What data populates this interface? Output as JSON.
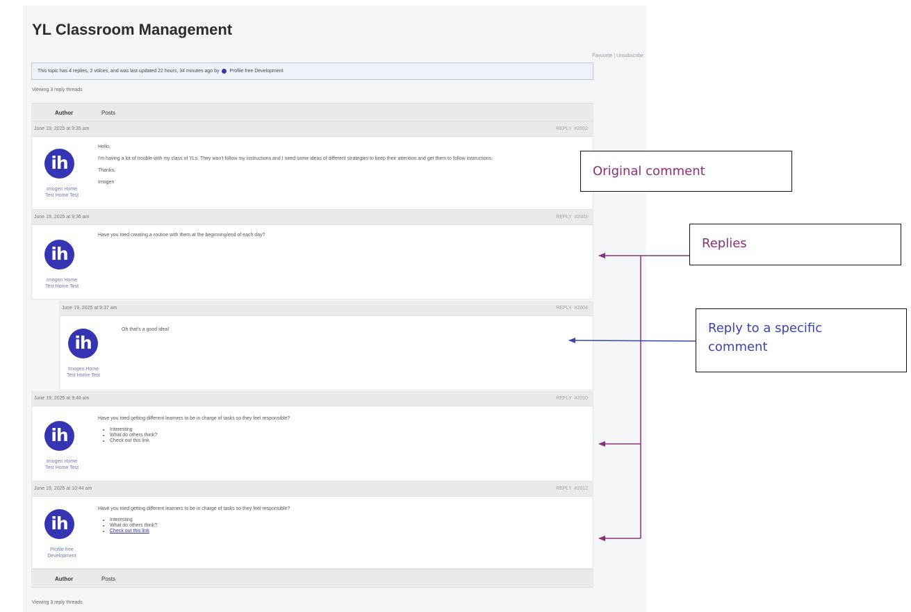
{
  "topic": {
    "title": "YL Classroom Management",
    "favorite_label": "Favourite",
    "separator": "|",
    "unsubscribe_label": "Unsubscribe",
    "notice_text": "This topic has 4 replies, 2 voices, and was last updated 22 hours, 34 minutes ago by",
    "notice_author": "Profile free Development",
    "viewing_text": "Viewing 3 reply threads",
    "col_author": "Author",
    "col_posts": "Posts"
  },
  "replies": [
    {
      "date": "June 19, 2025 at 9:35 am",
      "reply_label": "REPLY",
      "post_id": "#2002",
      "avatar_text": "ih",
      "author": [
        "Imogen Home",
        "Test Home Test"
      ],
      "paragraphs": [
        "Hello,",
        "I'm having a lot of trouble with my class of YLs. They won't follow my instructions and I need some ideas of different strategies to keep their attention and get them to follow instructions.",
        "Thanks,",
        "Imogen"
      ]
    },
    {
      "date": "June 19, 2025 at 9:36 am",
      "reply_label": "REPLY",
      "post_id": "#2003",
      "avatar_text": "ih",
      "author": [
        "Imogen Home",
        "Test Home Test"
      ],
      "paragraphs": [
        "Have you tried creating a routine with them at the beginning/end of each day?"
      ]
    },
    {
      "date": "June 19, 2025 at 9:37 am",
      "reply_label": "REPLY",
      "post_id": "#2004",
      "avatar_text": "ih",
      "author": [
        "Imogen Home",
        "Test Home Test"
      ],
      "paragraphs": [
        "Oh that's a good idea!"
      ]
    },
    {
      "date": "June 19, 2025 at 9:48 am",
      "reply_label": "REPLY",
      "post_id": "#2010",
      "avatar_text": "ih",
      "author": [
        "Imogen Home",
        "Test Home Test"
      ],
      "paragraphs": [
        "Have you tried getting different learners to be in charge of tasks so they feel responsible?"
      ],
      "list": [
        "Interesting",
        "What do others think?",
        "Check out this link"
      ]
    },
    {
      "date": "June 19, 2025 at 10:44 am",
      "reply_label": "REPLY",
      "post_id": "#2012",
      "avatar_text": "ih",
      "author": [
        "Profile free",
        "Development"
      ],
      "paragraphs": [
        "Have you tried getting different learners to be in charge of tasks so they feel responsible?"
      ],
      "list": [
        "Interesting",
        "What do others think?",
        "Check out this link"
      ]
    }
  ],
  "annotations": {
    "original": "Original comment",
    "replies": "Replies",
    "specific_line1": "Reply to a specific",
    "specific_line2": "comment",
    "color_purple": "#8b2f7a",
    "color_blue": "#3a44b0"
  },
  "colors": {
    "avatar": "#3535b3",
    "header_bg": "#eaeaea",
    "page_bg": "#f4f6f8",
    "notice_bg": "#eef3fa"
  }
}
